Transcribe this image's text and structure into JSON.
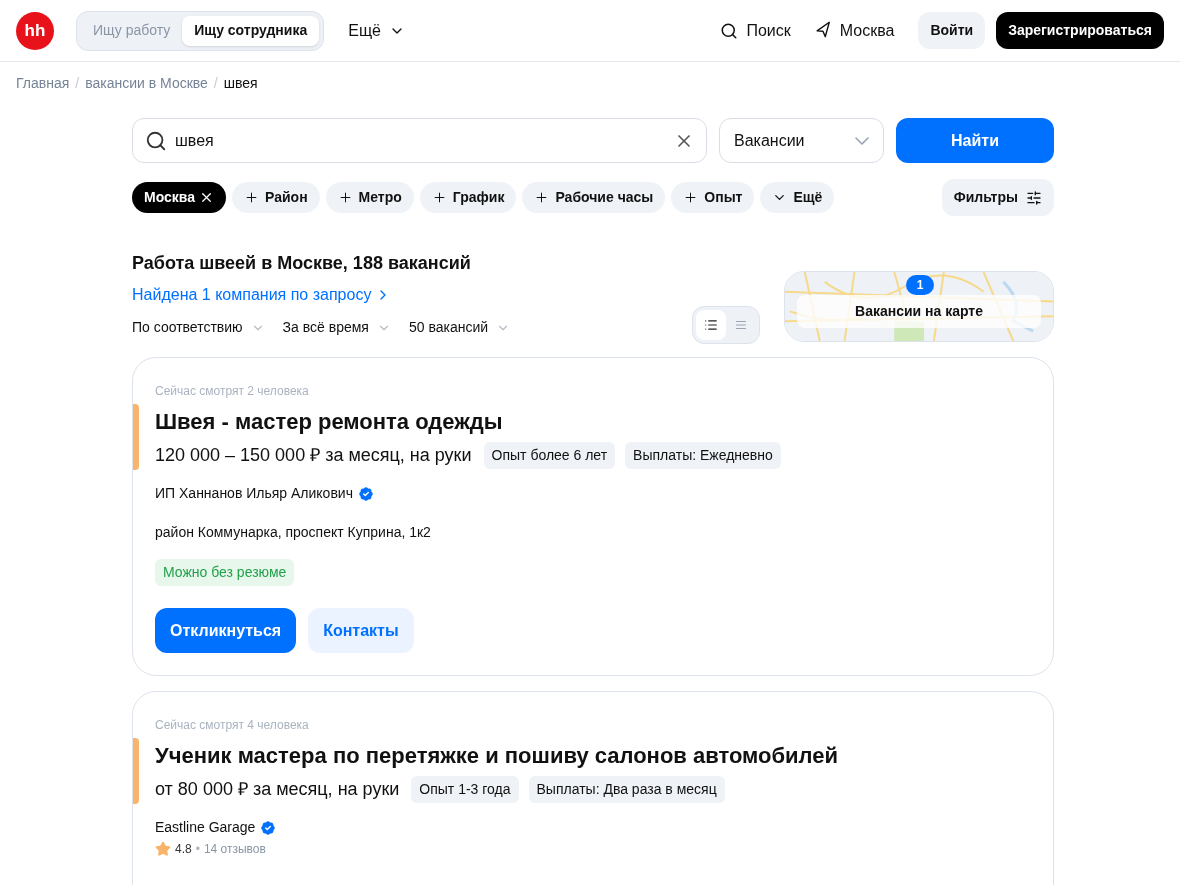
{
  "header": {
    "logo": "hh",
    "modes": [
      {
        "label": "Ищу работу",
        "selected": false
      },
      {
        "label": "Ищу сотрудника",
        "selected": true
      }
    ],
    "more": "Ещё",
    "search": "Поиск",
    "city": "Москва",
    "login": "Войти",
    "register": "Зарегистрироваться"
  },
  "breadcrumbs": [
    {
      "label": "Главная",
      "current": false
    },
    {
      "label": "вакансии в Москве",
      "current": false,
      "separator": "/"
    },
    {
      "label": "швея",
      "current": true,
      "separator": "/"
    }
  ],
  "search": {
    "value": "швея",
    "type": "Вакансии",
    "submit": "Найти"
  },
  "chips": [
    {
      "label": "Москва",
      "selected": true,
      "kind": "add"
    },
    {
      "label": "Район",
      "selected": false,
      "kind": "add"
    },
    {
      "label": "Метро",
      "selected": false,
      "kind": "add"
    },
    {
      "label": "График",
      "selected": false,
      "kind": "add"
    },
    {
      "label": "Рабочие часы",
      "selected": false,
      "kind": "add"
    },
    {
      "label": "Опыт",
      "selected": false,
      "kind": "add"
    },
    {
      "label": "Ещё",
      "selected": false,
      "kind": "more"
    }
  ],
  "filters": "Фильтры",
  "results": {
    "title": "Работа швеей в Москве, 188 вакансий",
    "company_link": "Найдена 1 компания по запросу",
    "sorts": [
      "По соответствию",
      "За всё время",
      "50 вакансий"
    ],
    "view_modes": [
      {
        "selected": true
      },
      {
        "selected": false
      }
    ],
    "map": {
      "badge": "1",
      "label": "Вакансии на карте"
    }
  },
  "vacancies": [
    {
      "viewers": "Сейчас смотрят 2 человека",
      "title": "Швея - мастер ремонта одежды",
      "salary": "120 000 – 150 000 ₽ за месяц, на руки",
      "tags": [
        "Опыт более 6 лет",
        "Выплаты: Ежедневно"
      ],
      "company": "ИП Ханнанов Ильяр Аликович",
      "verified": true,
      "address": "район Коммунарка, проспект Куприна, 1к2",
      "badge": "Можно без резюме",
      "apply": "Откликнуться",
      "contacts": "Контакты"
    },
    {
      "viewers": "Сейчас смотрят 4 человека",
      "title": "Ученик мастера по перетяжке и пошиву салонов автомобилей",
      "salary": "от 80 000 ₽ за месяц, на руки",
      "tags": [
        "Опыт 1-3 года",
        "Выплаты: Два раза в месяц"
      ],
      "company": "Eastline Garage",
      "verified": true,
      "rating": "4.8",
      "rating_separator": "•",
      "reviews": "14 отзывов"
    }
  ]
}
